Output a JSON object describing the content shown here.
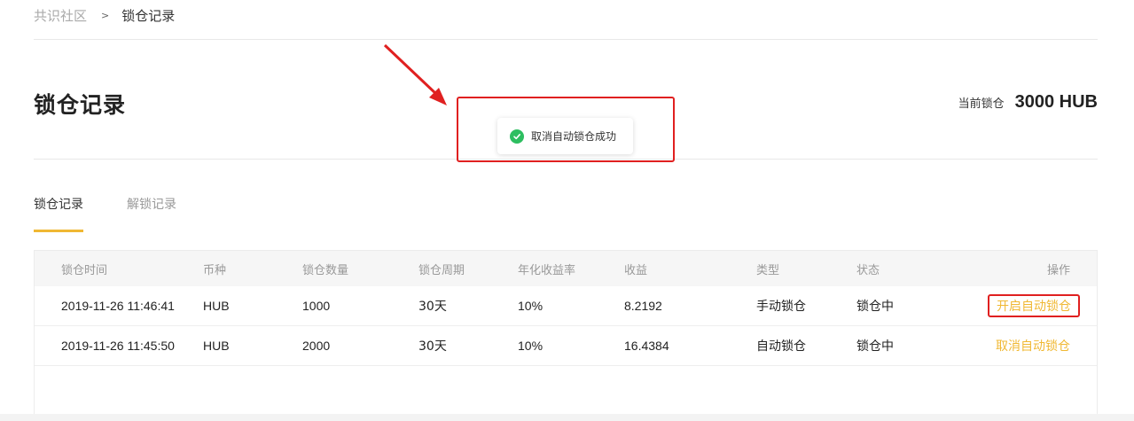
{
  "breadcrumb": {
    "root": "共识社区",
    "separator": ">",
    "current": "锁仓记录"
  },
  "page": {
    "title": "锁仓记录",
    "current_lock_label": "当前锁仓",
    "current_lock_value": "3000 HUB"
  },
  "toast": {
    "icon": "check-circle-icon",
    "message": "取消自动锁仓成功",
    "icon_color": "#2dbe60"
  },
  "tabs": [
    {
      "label": "锁仓记录",
      "active": true
    },
    {
      "label": "解锁记录",
      "active": false
    }
  ],
  "table": {
    "headers": [
      "锁仓时间",
      "币种",
      "锁仓数量",
      "锁仓周期",
      "年化收益率",
      "收益",
      "类型",
      "状态",
      "操作"
    ],
    "rows": [
      {
        "time": "2019-11-26 11:46:41",
        "coin": "HUB",
        "qty": "1000",
        "period": "30天",
        "rate": "10%",
        "profit": "8.2192",
        "type": "手动锁仓",
        "status": "锁仓中",
        "action": "开启自动锁仓"
      },
      {
        "time": "2019-11-26 11:45:50",
        "coin": "HUB",
        "qty": "2000",
        "period": "30天",
        "rate": "10%",
        "profit": "16.4384",
        "type": "自动锁仓",
        "status": "锁仓中",
        "action": "取消自动锁仓"
      }
    ]
  },
  "colors": {
    "accent": "#f0b833",
    "annotation": "#e02020",
    "success": "#2dbe60"
  }
}
